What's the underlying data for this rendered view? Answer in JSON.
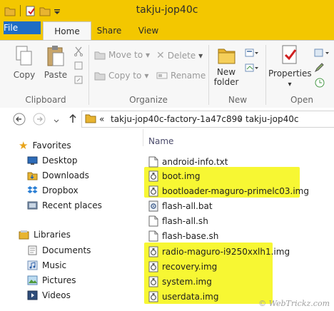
{
  "window": {
    "title": "takju-jop40c"
  },
  "ribbon_tabs": [
    "File",
    "Home",
    "Share",
    "View"
  ],
  "clipboard": {
    "copy": "Copy",
    "paste": "Paste",
    "group": "Clipboard"
  },
  "organize": {
    "move_to": "Move to",
    "copy_to": "Copy to",
    "delete": "Delete",
    "rename": "Rename",
    "group": "Organize"
  },
  "new_group": {
    "new_folder_line1": "New",
    "new_folder_line2": "folder",
    "group": "New"
  },
  "open_group": {
    "properties": "Properties",
    "group": "Open"
  },
  "address": {
    "overflow": "«",
    "crumb1": "takju-jop40c-factory-1a47c890",
    "sep": "›",
    "crumb2": "takju-jop40c"
  },
  "nav": {
    "favorites": "Favorites",
    "favorites_items": [
      "Desktop",
      "Downloads",
      "Dropbox",
      "Recent places"
    ],
    "libraries": "Libraries",
    "library_items": [
      "Documents",
      "Music",
      "Pictures",
      "Videos"
    ]
  },
  "content": {
    "column_name": "Name",
    "files": [
      {
        "name": "android-info.txt",
        "icon": "text-file-icon",
        "highlighted": false
      },
      {
        "name": "boot.img",
        "icon": "img-file-icon",
        "highlighted": true
      },
      {
        "name": "bootloader-maguro-primelc03.img",
        "icon": "img-file-icon",
        "highlighted": true
      },
      {
        "name": "flash-all.bat",
        "icon": "batch-file-icon",
        "highlighted": false
      },
      {
        "name": "flash-all.sh",
        "icon": "text-file-icon",
        "highlighted": false
      },
      {
        "name": "flash-base.sh",
        "icon": "text-file-icon",
        "highlighted": false
      },
      {
        "name": "radio-maguro-i9250xxlh1.img",
        "icon": "img-file-icon",
        "highlighted": true
      },
      {
        "name": "recovery.img",
        "icon": "img-file-icon",
        "highlighted": true
      },
      {
        "name": "system.img",
        "icon": "img-file-icon",
        "highlighted": true
      },
      {
        "name": "userdata.img",
        "icon": "img-file-icon",
        "highlighted": true
      }
    ]
  },
  "watermark": "© WebTrickz.com",
  "colors": {
    "title_bar": "#f3c700",
    "file_tab": "#1f6dc5",
    "highlight": "#f7f733"
  }
}
